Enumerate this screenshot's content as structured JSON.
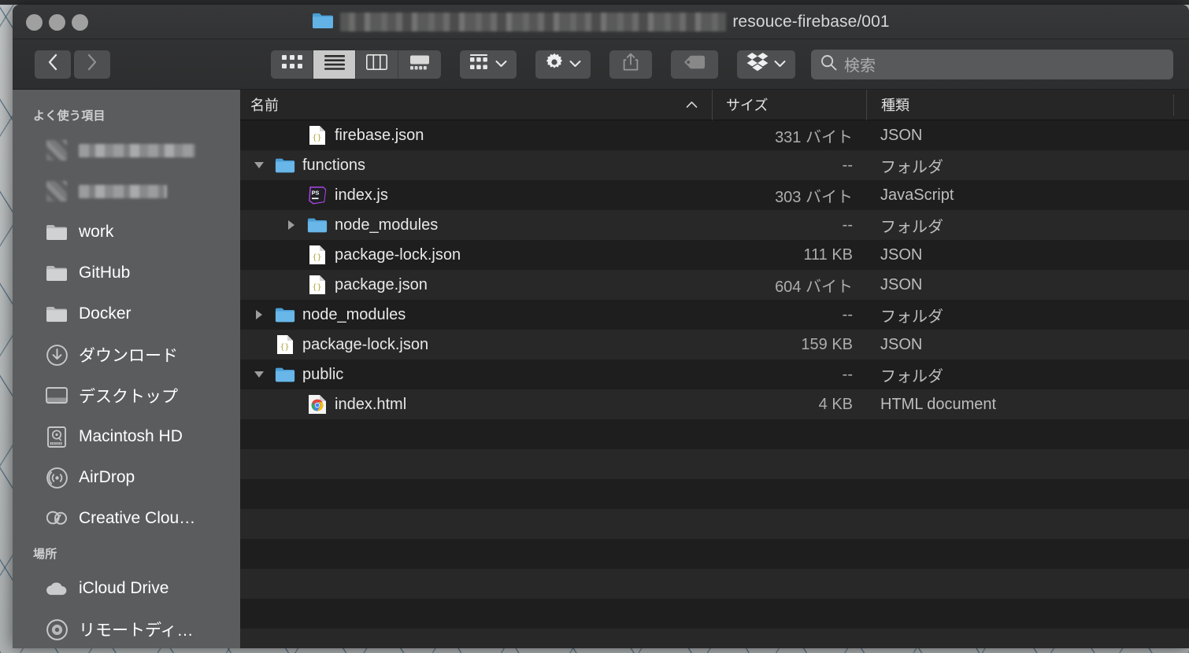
{
  "window": {
    "title_redacted": true,
    "title_text": "resouce-firebase/001",
    "title_icon": "folder-icon"
  },
  "toolbar": {
    "back_icon": "chevron-left-icon",
    "forward_icon": "chevron-right-icon",
    "view_icon": "icon-view-icon",
    "view_list": "list-view-icon",
    "view_column": "column-view-icon",
    "view_gallery": "gallery-view-icon",
    "group_icon": "group-by-icon",
    "action_icon": "gear-icon",
    "share_icon": "share-icon",
    "tag_icon": "tag-icon",
    "dropbox_icon": "dropbox-icon",
    "chevron_icon": "chevron-down-icon"
  },
  "search": {
    "icon": "search-icon",
    "placeholder": "検索",
    "value": ""
  },
  "sidebar": {
    "sections": [
      {
        "header": "よく使う項目",
        "items": [
          {
            "label": "",
            "icon": "blurred-icon",
            "redacted": true,
            "redacted_width": 148
          },
          {
            "label": "",
            "icon": "blurred-icon",
            "redacted": true,
            "redacted_width": 112
          },
          {
            "label": "work",
            "icon": "folder-icon"
          },
          {
            "label": "GitHub",
            "icon": "folder-icon"
          },
          {
            "label": "Docker",
            "icon": "folder-icon"
          },
          {
            "label": "ダウンロード",
            "icon": "downloads-icon"
          },
          {
            "label": "デスクトップ",
            "icon": "desktop-icon"
          },
          {
            "label": "Macintosh HD",
            "icon": "harddisk-icon"
          },
          {
            "label": "AirDrop",
            "icon": "airdrop-icon"
          },
          {
            "label": "Creative Clou…",
            "icon": "creative-cloud-icon"
          }
        ]
      },
      {
        "header": "場所",
        "items": [
          {
            "label": "iCloud Drive",
            "icon": "cloud-icon"
          },
          {
            "label": "リモートディ…",
            "icon": "disc-icon"
          }
        ]
      }
    ]
  },
  "filelist": {
    "columns": [
      {
        "label": "名前",
        "sort": "ascending",
        "sort_icon": "chevron-up-icon"
      },
      {
        "label": "サイズ"
      },
      {
        "label": "種類"
      }
    ],
    "rows": [
      {
        "name": "firebase.json",
        "size": "331 バイト",
        "kind": "JSON",
        "icon": "json-file-icon",
        "indent": 1,
        "disclosure": ""
      },
      {
        "name": "functions",
        "size": "--",
        "kind": "フォルダ",
        "icon": "folder-icon",
        "indent": 0,
        "disclosure": "expanded"
      },
      {
        "name": "index.js",
        "size": "303 バイト",
        "kind": "JavaScript",
        "icon": "phpstorm-icon",
        "indent": 1,
        "disclosure": ""
      },
      {
        "name": "node_modules",
        "size": "--",
        "kind": "フォルダ",
        "icon": "folder-icon",
        "indent": 1,
        "disclosure": "collapsed"
      },
      {
        "name": "package-lock.json",
        "size": "111 KB",
        "kind": "JSON",
        "icon": "json-file-icon",
        "indent": 1,
        "disclosure": ""
      },
      {
        "name": "package.json",
        "size": "604 バイト",
        "kind": "JSON",
        "icon": "json-file-icon",
        "indent": 1,
        "disclosure": ""
      },
      {
        "name": "node_modules",
        "size": "--",
        "kind": "フォルダ",
        "icon": "folder-icon",
        "indent": 0,
        "disclosure": "collapsed"
      },
      {
        "name": "package-lock.json",
        "size": "159 KB",
        "kind": "JSON",
        "icon": "json-file-icon",
        "indent": 0,
        "disclosure": ""
      },
      {
        "name": "public",
        "size": "--",
        "kind": "フォルダ",
        "icon": "folder-icon",
        "indent": 0,
        "disclosure": "expanded"
      },
      {
        "name": "index.html",
        "size": "4 KB",
        "kind": "HTML document",
        "icon": "chrome-icon",
        "indent": 1,
        "disclosure": ""
      }
    ],
    "empty_row_count": 8
  },
  "colors": {
    "window_bg": "#2b2b2b",
    "sidebar_bg": "#5b5c5e",
    "list_bg_odd": "#1e1e1e",
    "list_bg_even": "#282828",
    "folder_blue": "#5ea9dd",
    "accent_text": "#e8e8e8"
  }
}
